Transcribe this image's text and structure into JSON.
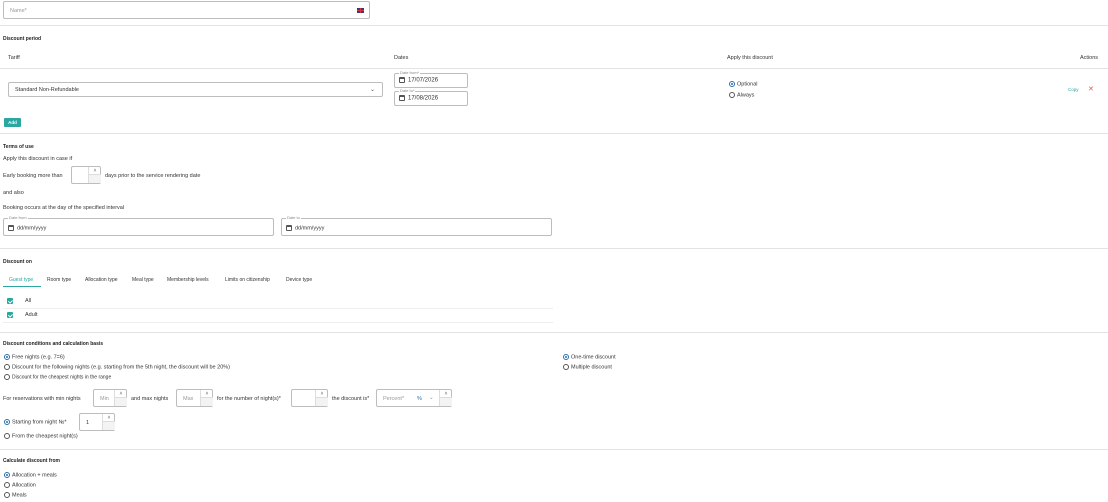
{
  "name_field": {
    "placeholder": "Name*",
    "flag_icon": "uk-flag-icon"
  },
  "discount_period": {
    "title": "Discount period",
    "columns": {
      "tariff": "Tariff",
      "dates": "Dates",
      "apply": "Apply this discount",
      "actions": "Actions"
    },
    "tariff_value": "Standard Non-Refundable",
    "date_from_label": "Date from*",
    "date_from_value": "17/07/2026",
    "date_to_label": "Date to*",
    "date_to_value": "17/08/2026",
    "apply_options": [
      "Optional",
      "Always"
    ],
    "apply_selected": "Optional",
    "copy_label": "Copy",
    "delete_icon": "close-icon",
    "add_label": "Add"
  },
  "terms": {
    "title": "Terms of use",
    "apply_if": "Apply this discount in case if",
    "early_prefix": "Early booking more than",
    "early_suffix": "days prior to the service rendering date",
    "and_also": "and also",
    "booking_occurs": "Booking occurs at the day of the specified interval",
    "date_from_label": "Date from",
    "date_to_label": "Date to",
    "date_placeholder": "dd/mm/yyyy"
  },
  "discount_on": {
    "title": "Discount on",
    "tabs": [
      "Guest type",
      "Room type",
      "Allocation type",
      "Meal type",
      "Membership levels",
      "Limits on citizenship",
      "Device type"
    ],
    "active_tab": "Guest type",
    "items": [
      "All",
      "Adult"
    ]
  },
  "conditions": {
    "title": "Discount conditions and calculation basis",
    "basis_options": [
      "Free nights (e.g. 7=6)",
      "Discount for the following nights (e.g. starting from the 5th night, the discount will be 20%)",
      "Discount for the cheapest nights in the range"
    ],
    "frequency_options": [
      "One-time discount",
      "Multiple discount"
    ],
    "for_reservations": "For reservations with min nights",
    "min_placeholder": "Min",
    "and_max": "and max nights",
    "max_placeholder": "Max",
    "for_number": "for the number of night(s)*",
    "discount_is": "the discount is*",
    "percent_placeholder": "Percent*",
    "percent_symbol": "%",
    "starting_from": "Starting from night №*",
    "starting_value": "1",
    "from_cheapest": "From the cheapest night(s)"
  },
  "calculate_from": {
    "title": "Calculate discount from",
    "options": [
      "Allocation + meals",
      "Allocation",
      "Meals"
    ]
  }
}
